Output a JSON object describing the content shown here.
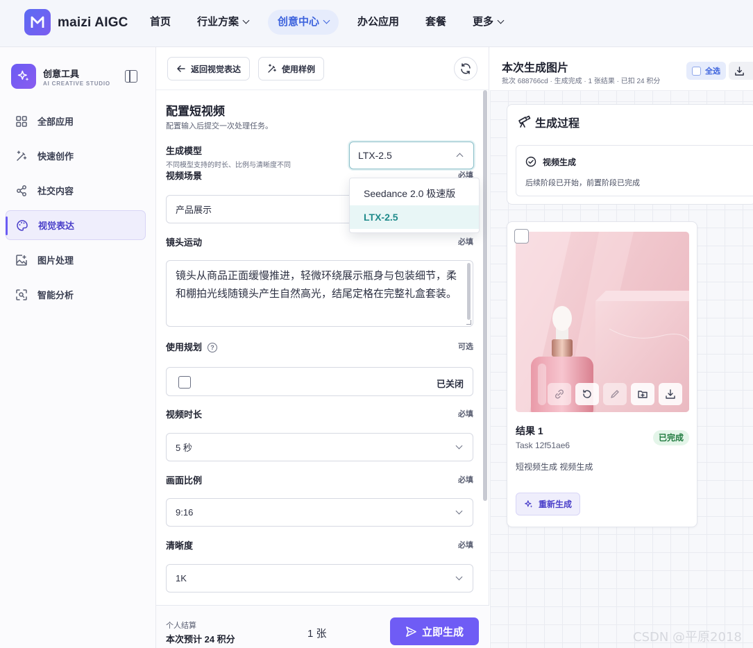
{
  "topnav": {
    "brand": "maizi AIGC",
    "items": [
      {
        "label": "首页",
        "has_menu": false,
        "active": false
      },
      {
        "label": "行业方案",
        "has_menu": true,
        "active": false
      },
      {
        "label": "创意中心",
        "has_menu": true,
        "active": true
      },
      {
        "label": "办公应用",
        "has_menu": false,
        "active": false
      },
      {
        "label": "套餐",
        "has_menu": false,
        "active": false
      },
      {
        "label": "更多",
        "has_menu": true,
        "active": false
      }
    ]
  },
  "sidebar": {
    "title": "创意工具",
    "subtitle": "AI CREATIVE STUDIO",
    "items": [
      {
        "label": "全部应用",
        "icon": "grid-icon"
      },
      {
        "label": "快速创作",
        "icon": "magic-wand-icon"
      },
      {
        "label": "社交内容",
        "icon": "share-icon"
      },
      {
        "label": "视觉表达",
        "icon": "palette-icon",
        "active": true
      },
      {
        "label": "图片处理",
        "icon": "image-edit-icon"
      },
      {
        "label": "智能分析",
        "icon": "scan-icon"
      }
    ]
  },
  "form": {
    "back_label": "返回视觉表达",
    "sample_label": "使用样例",
    "title": "配置短视频",
    "subtitle": "配置输入后提交一次处理任务。",
    "model": {
      "label": "生成模型",
      "hint": "不同模型支持的时长、比例与清晰度不同",
      "value": "LTX-2.5",
      "options": [
        "Seedance 2.0 极速版",
        "LTX-2.5"
      ]
    },
    "scene": {
      "label": "视频场景",
      "required": "必填",
      "value": "产品展示"
    },
    "motion": {
      "label": "镜头运动",
      "required": "必填",
      "value": "镜头从商品正面缓慢推进，轻微环绕展示瓶身与包装细节，柔和棚拍光线随镜头产生自然高光，结尾定格在完整礼盒套装。"
    },
    "plan": {
      "label": "使用规划",
      "optional": "可选",
      "status": "已关闭"
    },
    "duration": {
      "label": "视频时长",
      "required": "必填",
      "value": "5 秒"
    },
    "ratio": {
      "label": "画面比例",
      "required": "必填",
      "value": "9:16"
    },
    "resolution": {
      "label": "清晰度",
      "required": "必填",
      "value": "1K"
    }
  },
  "footer": {
    "label": "个人结算",
    "estimate": "本次预计 24 积分",
    "count": "1 张",
    "generate_label": "立即生成"
  },
  "results": {
    "title": "本次生成图片",
    "meta": "批次 688766cd · 生成完成 · 1 张结果 · 已扣 24 积分",
    "select_all": "全选",
    "process": {
      "title": "生成过程",
      "step": "视频生成",
      "desc": "后续阶段已开始，前置阶段已完成"
    },
    "card": {
      "name": "结果 1",
      "task": "Task 12f51ae6",
      "status": "已完成",
      "tags": "短视频生成 视频生成",
      "regen_label": "重新生成"
    }
  },
  "watermark": "CSDN @平原2018",
  "colors": {
    "accent": "#6f5cf5",
    "nav_active": "#3d63dd",
    "selected_option": "#1e8a8a",
    "success": "#1f7a3e"
  }
}
